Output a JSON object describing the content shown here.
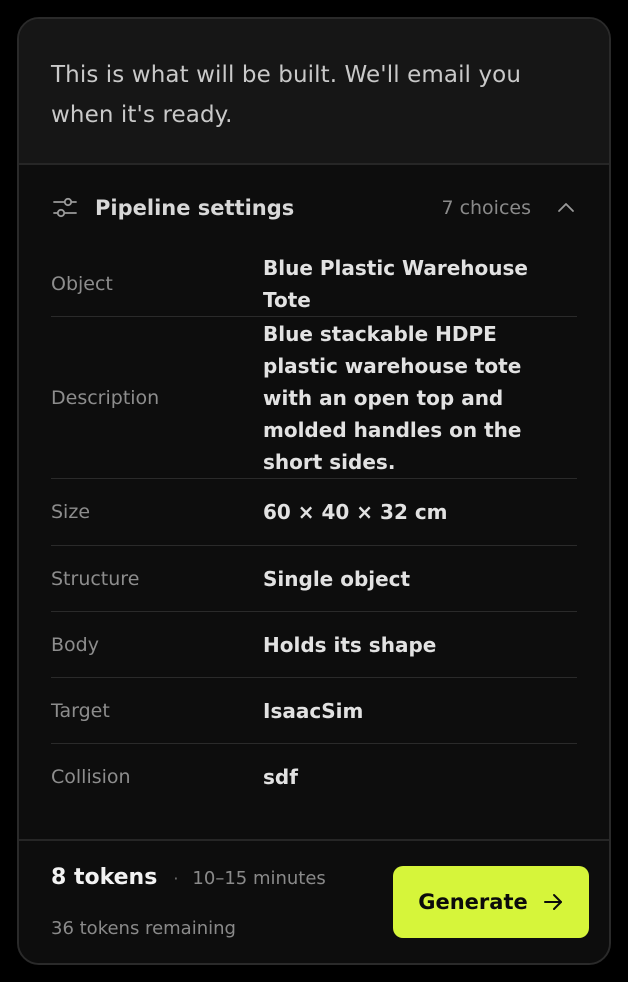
{
  "intro": {
    "text": "This is what will be built. We'll email you when it's ready."
  },
  "settings": {
    "title": "Pipeline settings",
    "choices": "7 choices",
    "expanded": true,
    "icon": "sliders-icon",
    "rows": [
      {
        "label": "Object",
        "value": "Blue Plastic Warehouse Tote"
      },
      {
        "label": "Description",
        "value": "Blue stackable HDPE plastic warehouse tote with an open top and molded handles on the short sides."
      },
      {
        "label": "Size",
        "value": "60 × 40 × 32 cm"
      },
      {
        "label": "Structure",
        "value": "Single object"
      },
      {
        "label": "Body",
        "value": "Holds its shape"
      },
      {
        "label": "Target",
        "value": "IsaacSim"
      },
      {
        "label": "Collision",
        "value": "sdf"
      }
    ]
  },
  "footer": {
    "tokens": "8 tokens",
    "separator": "·",
    "duration": "10–15 minutes",
    "remaining": "36 tokens remaining",
    "generate_label": "Generate"
  },
  "colors": {
    "accent": "#d6f53a",
    "card_bg": "#0d0d0d",
    "intro_bg": "#161616"
  }
}
